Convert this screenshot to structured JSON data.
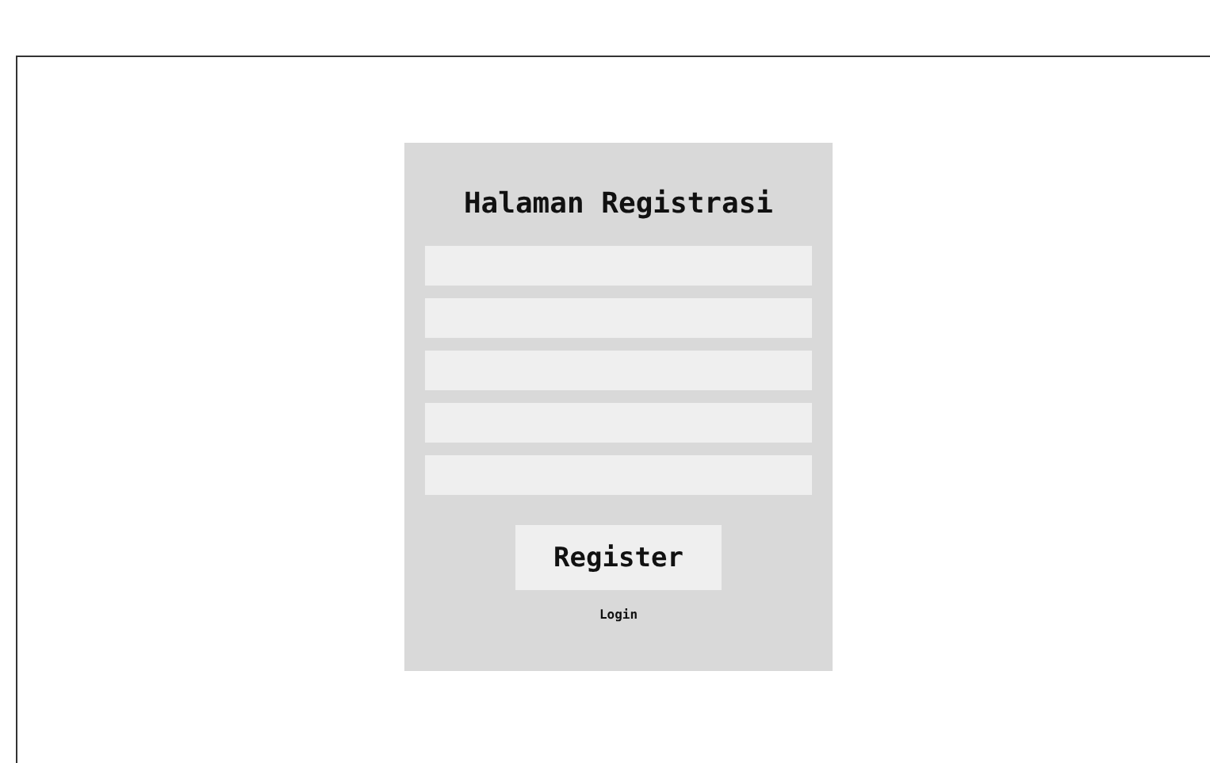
{
  "form": {
    "title": "Halaman Registrasi",
    "fields": [
      {
        "kind": "text"
      },
      {
        "kind": "text"
      },
      {
        "kind": "text"
      },
      {
        "kind": "text"
      },
      {
        "kind": "text"
      }
    ],
    "submit_button": "Register",
    "login_link": "Login"
  }
}
